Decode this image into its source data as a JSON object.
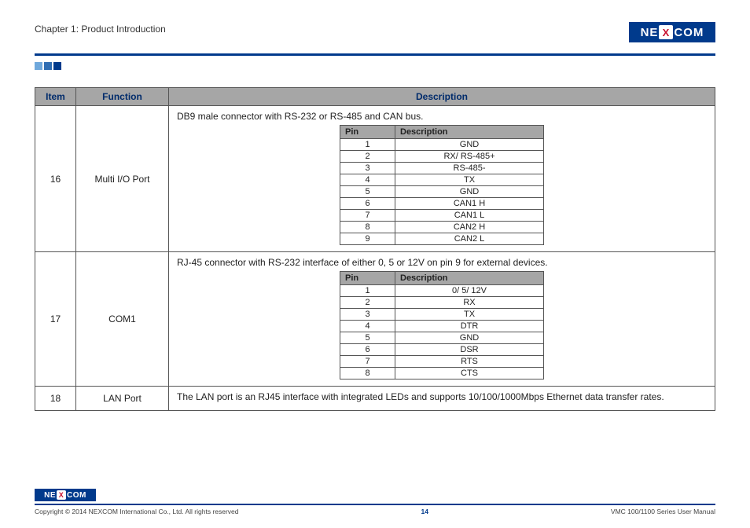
{
  "header": {
    "chapter": "Chapter 1: Product Introduction",
    "logo_left": "NE",
    "logo_x": "X",
    "logo_right": "COM"
  },
  "table": {
    "headers": {
      "item": "Item",
      "function": "Function",
      "description": "Description"
    },
    "pin_headers": {
      "pin": "Pin",
      "desc": "Description"
    },
    "rows": [
      {
        "item": "16",
        "function": "Multi I/O Port",
        "desc_text": "DB9 male connector with RS-232 or RS-485 and CAN bus.",
        "pins": [
          {
            "pin": "1",
            "desc": "GND"
          },
          {
            "pin": "2",
            "desc": "RX/ RS-485+"
          },
          {
            "pin": "3",
            "desc": "RS-485-"
          },
          {
            "pin": "4",
            "desc": "TX"
          },
          {
            "pin": "5",
            "desc": "GND"
          },
          {
            "pin": "6",
            "desc": "CAN1 H"
          },
          {
            "pin": "7",
            "desc": "CAN1 L"
          },
          {
            "pin": "8",
            "desc": "CAN2 H"
          },
          {
            "pin": "9",
            "desc": "CAN2 L"
          }
        ]
      },
      {
        "item": "17",
        "function": "COM1",
        "desc_text": "RJ-45 connector with RS-232 interface of either 0, 5 or 12V on pin 9 for external devices.",
        "pins": [
          {
            "pin": "1",
            "desc": "0/ 5/ 12V"
          },
          {
            "pin": "2",
            "desc": "RX"
          },
          {
            "pin": "3",
            "desc": "TX"
          },
          {
            "pin": "4",
            "desc": "DTR"
          },
          {
            "pin": "5",
            "desc": "GND"
          },
          {
            "pin": "6",
            "desc": "DSR"
          },
          {
            "pin": "7",
            "desc": "RTS"
          },
          {
            "pin": "8",
            "desc": "CTS"
          }
        ]
      },
      {
        "item": "18",
        "function": "LAN Port",
        "desc_text": "The LAN port is an RJ45 interface with integrated LEDs and supports 10/100/1000Mbps Ethernet data transfer rates.",
        "pins": []
      }
    ]
  },
  "footer": {
    "copyright": "Copyright © 2014 NEXCOM International Co., Ltd. All rights reserved",
    "page": "14",
    "doc": "VMC 100/1100 Series User Manual"
  }
}
